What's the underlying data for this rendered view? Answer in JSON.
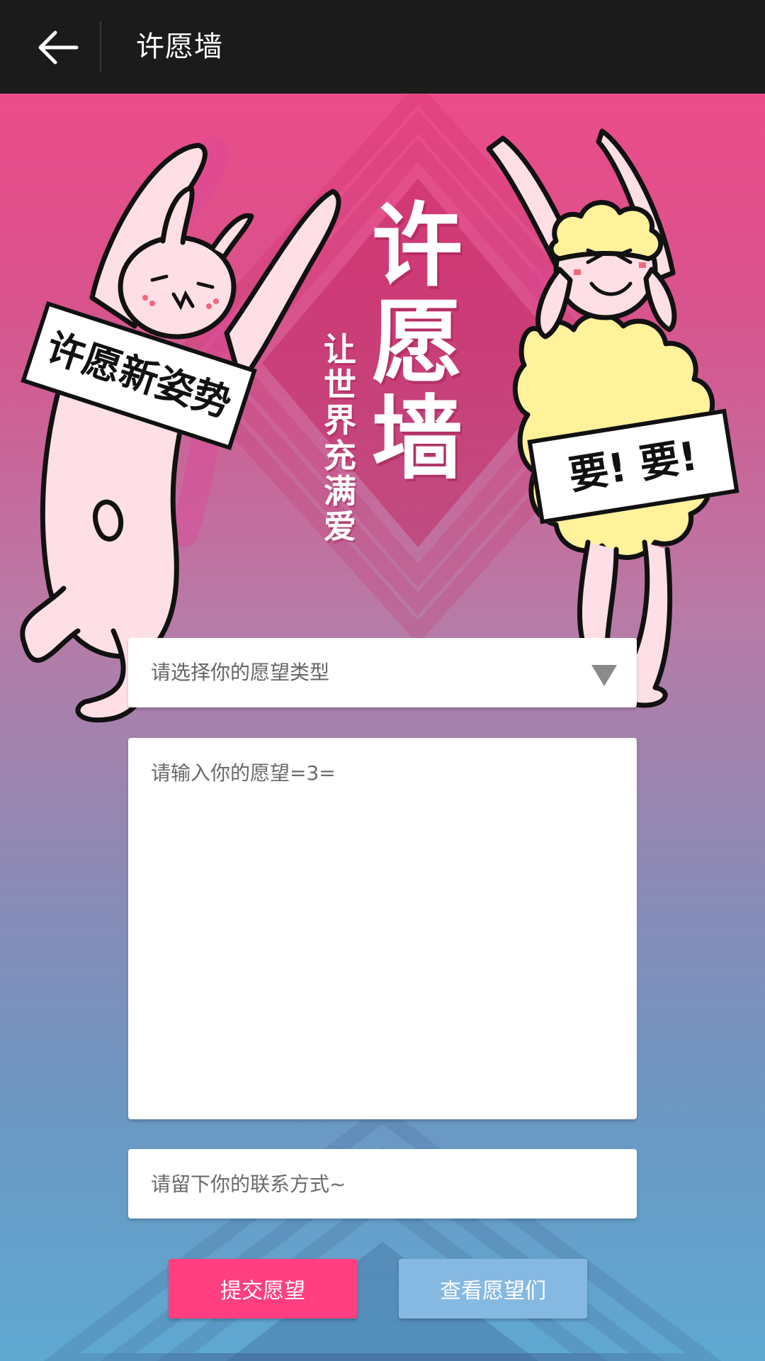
{
  "header": {
    "title": "许愿墙"
  },
  "poster": {
    "title_chars": [
      "许",
      "愿",
      "墙"
    ],
    "subtitle_chars": [
      "让",
      "世",
      "界",
      "充",
      "满",
      "爱"
    ],
    "left_sign": "许愿新姿势",
    "right_sign": "要! 要!"
  },
  "form": {
    "wish_type_placeholder": "请选择你的愿望类型",
    "wish_placeholder": "请输入你的愿望=3=",
    "contact_placeholder": "请留下你的联系方式~"
  },
  "buttons": {
    "submit": "提交愿望",
    "view": "查看愿望们"
  },
  "colors": {
    "topbar": "#1b1b1b",
    "submit_button": "#ff3f7f",
    "view_button": "#86b9e2"
  }
}
